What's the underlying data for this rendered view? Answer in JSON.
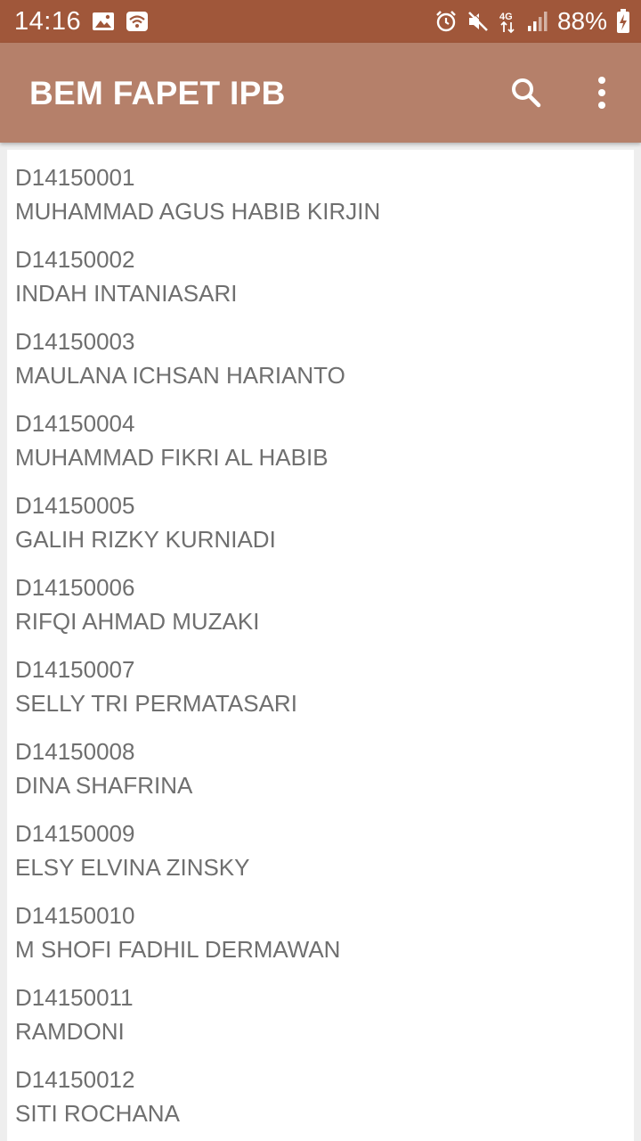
{
  "status_bar": {
    "time": "14:16",
    "battery_percent": "88%",
    "icons": [
      "image-icon",
      "wifi-icon",
      "alarm-icon",
      "mute-icon",
      "4g-icon",
      "signal-icon",
      "battery-charging-icon"
    ],
    "network_label": "4G"
  },
  "app_bar": {
    "title": "BEM FAPET IPB",
    "background_color": "#b5806a",
    "status_color": "#a0573a"
  },
  "students": [
    {
      "nim": "D14150001",
      "name": "MUHAMMAD AGUS HABIB KIRJIN"
    },
    {
      "nim": "D14150002",
      "name": "INDAH INTANIASARI"
    },
    {
      "nim": "D14150003",
      "name": "MAULANA ICHSAN HARIANTO"
    },
    {
      "nim": "D14150004",
      "name": "MUHAMMAD FIKRI AL HABIB"
    },
    {
      "nim": "D14150005",
      "name": "GALIH RIZKY KURNIADI"
    },
    {
      "nim": "D14150006",
      "name": "RIFQI AHMAD MUZAKI"
    },
    {
      "nim": "D14150007",
      "name": "SELLY TRI PERMATASARI"
    },
    {
      "nim": "D14150008",
      "name": "DINA SHAFRINA"
    },
    {
      "nim": "D14150009",
      "name": "ELSY ELVINA ZINSKY"
    },
    {
      "nim": "D14150010",
      "name": "M SHOFI FADHIL DERMAWAN"
    },
    {
      "nim": "D14150011",
      "name": "RAMDONI"
    },
    {
      "nim": "D14150012",
      "name": "SITI ROCHANA"
    }
  ]
}
